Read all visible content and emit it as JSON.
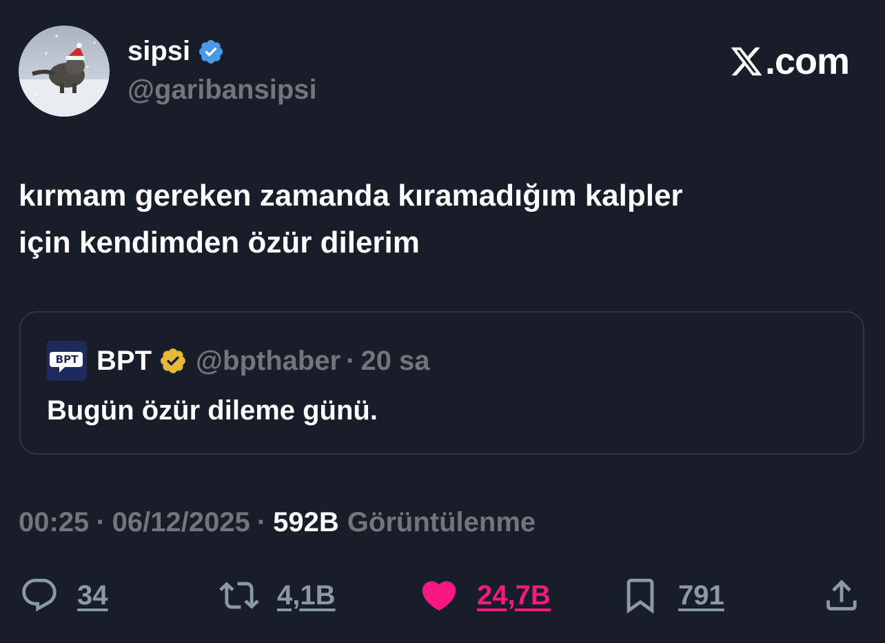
{
  "author": {
    "name": "sipsi",
    "handle": "@garibansipsi",
    "verified_color": "#4a99e9",
    "avatar_icon": "cat-in-snow-with-santa-hat"
  },
  "brand": {
    "icon": "x-logo-icon",
    "label": ".com"
  },
  "tweet": {
    "line1": "kırmam gereken zamanda kıramadığım kalpler",
    "line2": "için kendimden özür dilerim"
  },
  "quote": {
    "logo_text": "BPT",
    "name": "BPT",
    "badge_color": "#e8b83a",
    "handle": "@bpthaber",
    "dot": "·",
    "time": "20 sa",
    "text": "Bugün özür dileme günü."
  },
  "meta": {
    "time": "00:25",
    "dot1": "·",
    "date": "06/12/2025",
    "dot2": "·",
    "views_count": "592B",
    "views_label": "Görüntülenme"
  },
  "actions": {
    "replies": "34",
    "retweets": "4,1B",
    "likes": "24,7B",
    "bookmarks": "791"
  },
  "colors": {
    "background": "#181e29",
    "like": "#f91880",
    "muted": "#71767b"
  }
}
